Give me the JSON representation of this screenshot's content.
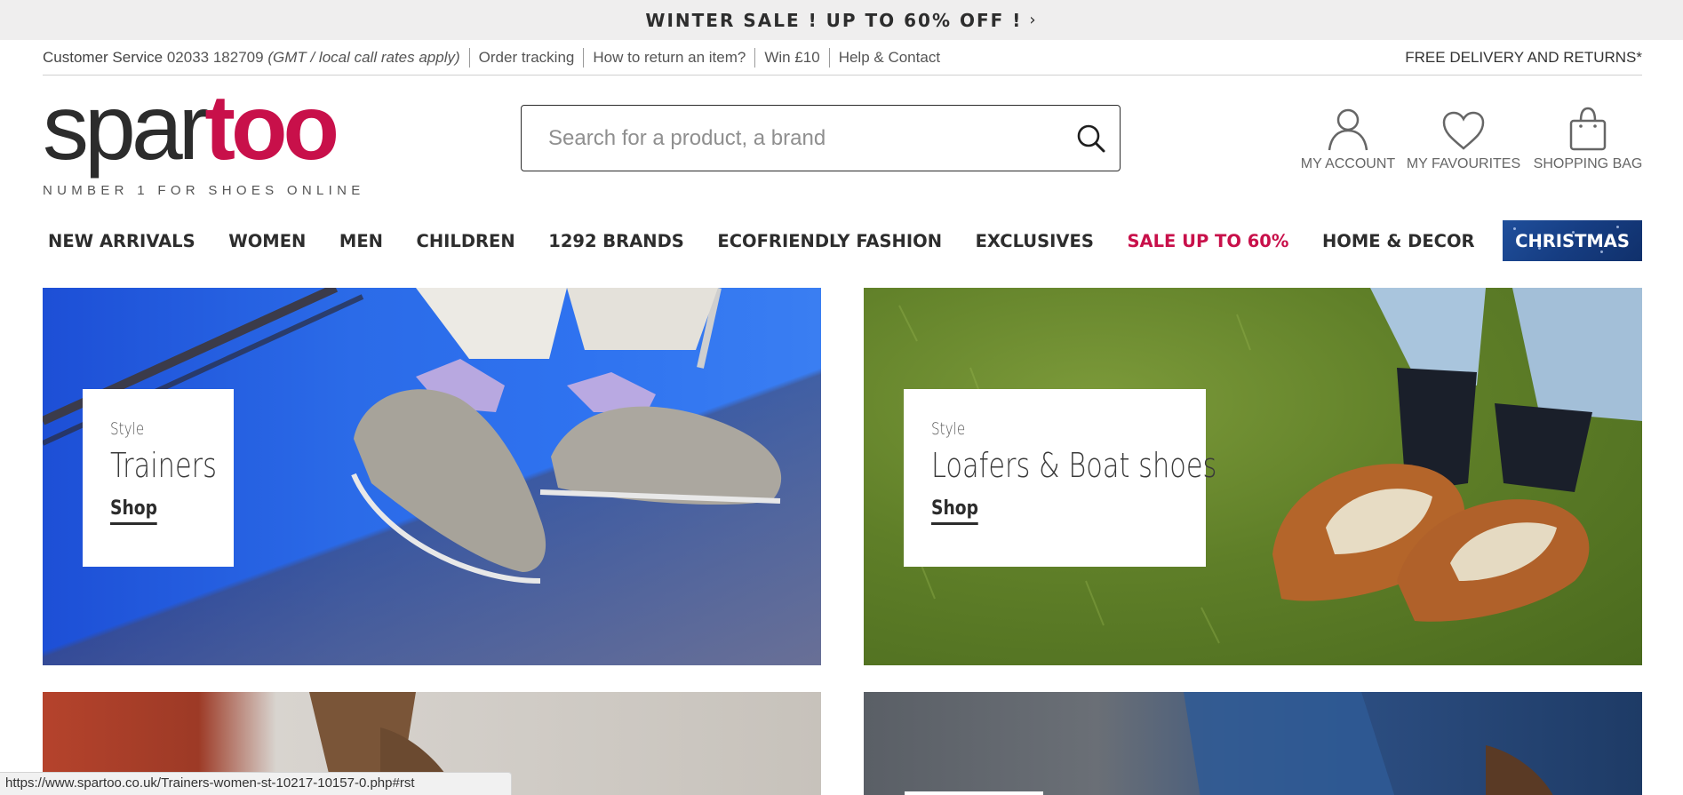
{
  "promo": {
    "text": "WINTER SALE ! UP TO 60% OFF !",
    "chevron": "›"
  },
  "utility": {
    "customer_service_label": "Customer Service",
    "phone": "02033 182709",
    "rates_note": "(GMT / local call rates apply)",
    "links": [
      "Order tracking",
      "How to return an item?",
      "Win £10",
      "Help & Contact"
    ],
    "free_delivery": "FREE DELIVERY AND RETURNS*"
  },
  "logo": {
    "part1": "spar",
    "part2": "too",
    "tagline": "NUMBER 1 FOR SHOES ONLINE"
  },
  "search": {
    "placeholder": "Search for a product, a brand",
    "icon": "search-icon"
  },
  "account": {
    "my_account": "MY ACCOUNT",
    "my_favourites": "MY FAVOURITES",
    "shopping_bag": "SHOPPING BAG"
  },
  "nav": {
    "items": [
      "NEW ARRIVALS",
      "WOMEN",
      "MEN",
      "CHILDREN",
      "1292 BRANDS",
      "ECOFRIENDLY FASHION",
      "EXCLUSIVES",
      "SALE UP TO 60%",
      "HOME & DECOR",
      "CHRISTMAS"
    ],
    "sale_color": "#c8104a"
  },
  "banners": [
    {
      "kicker": "Style",
      "title": "Trainers",
      "cta": "Shop"
    },
    {
      "kicker": "Style",
      "title": "Loafers & Boat shoes",
      "cta": "Shop"
    }
  ],
  "status_url": "https://www.spartoo.co.uk/Trainers-women-st-10217-10157-0.php#rst",
  "colors": {
    "brand": "#c8104a",
    "text_dark": "#2c2c2c",
    "christmas_bg": "#163d82"
  }
}
